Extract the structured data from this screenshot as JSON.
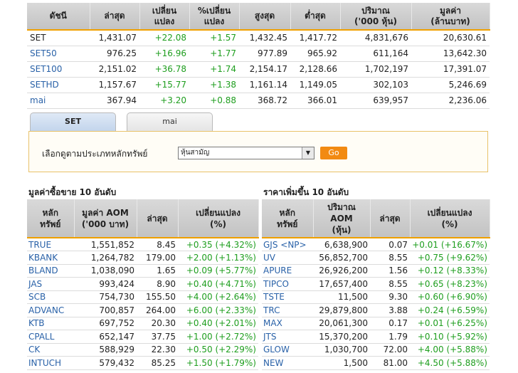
{
  "index_table": {
    "headers": [
      "ดัชนี",
      "ล่าสุด",
      "เปลี่ยนแปลง",
      "%เปลี่ยนแปลง",
      "สูงสุด",
      "ต่ำสุด",
      "ปริมาณ ('000 หุ้น)",
      "มูลค่า (ล้านบาท)"
    ],
    "header_lines": [
      [
        "ดัชนี"
      ],
      [
        "ล่าสุด"
      ],
      [
        "เปลี่ยน",
        "แปลง"
      ],
      [
        "%เปลี่ยน",
        "แปลง"
      ],
      [
        "สูงสุด"
      ],
      [
        "ต่ำสุด"
      ],
      [
        "ปริมาณ",
        "('000 หุ้น)"
      ],
      [
        "มูลค่า",
        "(ล้านบาท)"
      ]
    ],
    "rows": [
      {
        "name": "SET",
        "last": "1,431.07",
        "chg": "+22.08",
        "pct": "+1.57",
        "high": "1,432.45",
        "low": "1,417.72",
        "vol": "4,831,676",
        "val": "20,630.61"
      },
      {
        "name": "SET50",
        "last": "976.25",
        "chg": "+16.96",
        "pct": "+1.77",
        "high": "977.89",
        "low": "965.92",
        "vol": "611,164",
        "val": "13,642.30"
      },
      {
        "name": "SET100",
        "last": "2,151.02",
        "chg": "+36.78",
        "pct": "+1.74",
        "high": "2,154.17",
        "low": "2,128.66",
        "vol": "1,702,197",
        "val": "17,391.07"
      },
      {
        "name": "SETHD",
        "last": "1,157.67",
        "chg": "+15.77",
        "pct": "+1.38",
        "high": "1,161.14",
        "low": "1,149.05",
        "vol": "302,103",
        "val": "5,246.69"
      },
      {
        "name": "mai",
        "last": "367.94",
        "chg": "+3.20",
        "pct": "+0.88",
        "high": "368.72",
        "low": "366.01",
        "vol": "639,957",
        "val": "2,236.06"
      }
    ]
  },
  "tabs": {
    "set": "SET",
    "mai": "mai"
  },
  "selector": {
    "label": "เลือกดูตามประเภทหลักทรัพย์",
    "value": "หุ้นสามัญ",
    "go": "Go"
  },
  "left_section": {
    "title": "มูลค่าซื้อขาย 10 อันดับ",
    "header_lines": [
      [
        "หลัก",
        "ทรัพย์"
      ],
      [
        "มูลค่า AOM",
        "('000 บาท)"
      ],
      [
        "ล่าสุด"
      ],
      [
        "เปลี่ยนแปลง",
        "(%)"
      ]
    ],
    "rows": [
      {
        "sym": "TRUE",
        "val": "1,551,852",
        "last": "8.45",
        "chg": "+0.35 (+4.32%)"
      },
      {
        "sym": "KBANK",
        "val": "1,264,782",
        "last": "179.00",
        "chg": "+2.00 (+1.13%)"
      },
      {
        "sym": "BLAND",
        "val": "1,038,090",
        "last": "1.65",
        "chg": "+0.09 (+5.77%)"
      },
      {
        "sym": "JAS",
        "val": "993,424",
        "last": "8.90",
        "chg": "+0.40 (+4.71%)"
      },
      {
        "sym": "SCB",
        "val": "754,730",
        "last": "155.50",
        "chg": "+4.00 (+2.64%)"
      },
      {
        "sym": "ADVANC",
        "val": "700,857",
        "last": "264.00",
        "chg": "+6.00 (+2.33%)"
      },
      {
        "sym": "KTB",
        "val": "697,752",
        "last": "20.30",
        "chg": "+0.40 (+2.01%)"
      },
      {
        "sym": "CPALL",
        "val": "652,147",
        "last": "37.75",
        "chg": "+1.00 (+2.72%)"
      },
      {
        "sym": "CK",
        "val": "588,929",
        "last": "22.30",
        "chg": "+0.50 (+2.29%)"
      },
      {
        "sym": "INTUCH",
        "val": "579,432",
        "last": "85.25",
        "chg": "+1.50 (+1.79%)"
      }
    ]
  },
  "right_section": {
    "title": "ราคาเพิ่มขึ้น 10 อันดับ",
    "header_lines": [
      [
        "หลัก",
        "ทรัพย์"
      ],
      [
        "ปริมาณ",
        "AOM",
        "(หุ้น)"
      ],
      [
        "ล่าสุด"
      ],
      [
        "เปลี่ยนแปลง",
        "(%)"
      ]
    ],
    "rows": [
      {
        "sym": "GJS <NP>",
        "val": "6,638,900",
        "last": "0.07",
        "chg": "+0.01 (+16.67%)"
      },
      {
        "sym": "UV",
        "val": "56,852,700",
        "last": "8.55",
        "chg": "+0.75 (+9.62%)"
      },
      {
        "sym": "APURE",
        "val": "26,926,200",
        "last": "1.56",
        "chg": "+0.12 (+8.33%)"
      },
      {
        "sym": "TIPCO",
        "val": "17,657,400",
        "last": "8.55",
        "chg": "+0.65 (+8.23%)"
      },
      {
        "sym": "TSTE",
        "val": "11,500",
        "last": "9.30",
        "chg": "+0.60 (+6.90%)"
      },
      {
        "sym": "TRC",
        "val": "29,879,800",
        "last": "3.88",
        "chg": "+0.24 (+6.59%)"
      },
      {
        "sym": "MAX",
        "val": "20,061,300",
        "last": "0.17",
        "chg": "+0.01 (+6.25%)"
      },
      {
        "sym": "JTS",
        "val": "15,370,200",
        "last": "1.79",
        "chg": "+0.10 (+5.92%)"
      },
      {
        "sym": "GLOW",
        "val": "1,030,700",
        "last": "72.00",
        "chg": "+4.00 (+5.88%)"
      },
      {
        "sym": "NEW",
        "val": "1,500",
        "last": "81.00",
        "chg": "+4.50 (+5.88%)"
      }
    ]
  },
  "colors": {
    "up": "#1e9e1e",
    "link": "#2a62a8",
    "accent": "#f0a000",
    "go": "#f28a12"
  }
}
